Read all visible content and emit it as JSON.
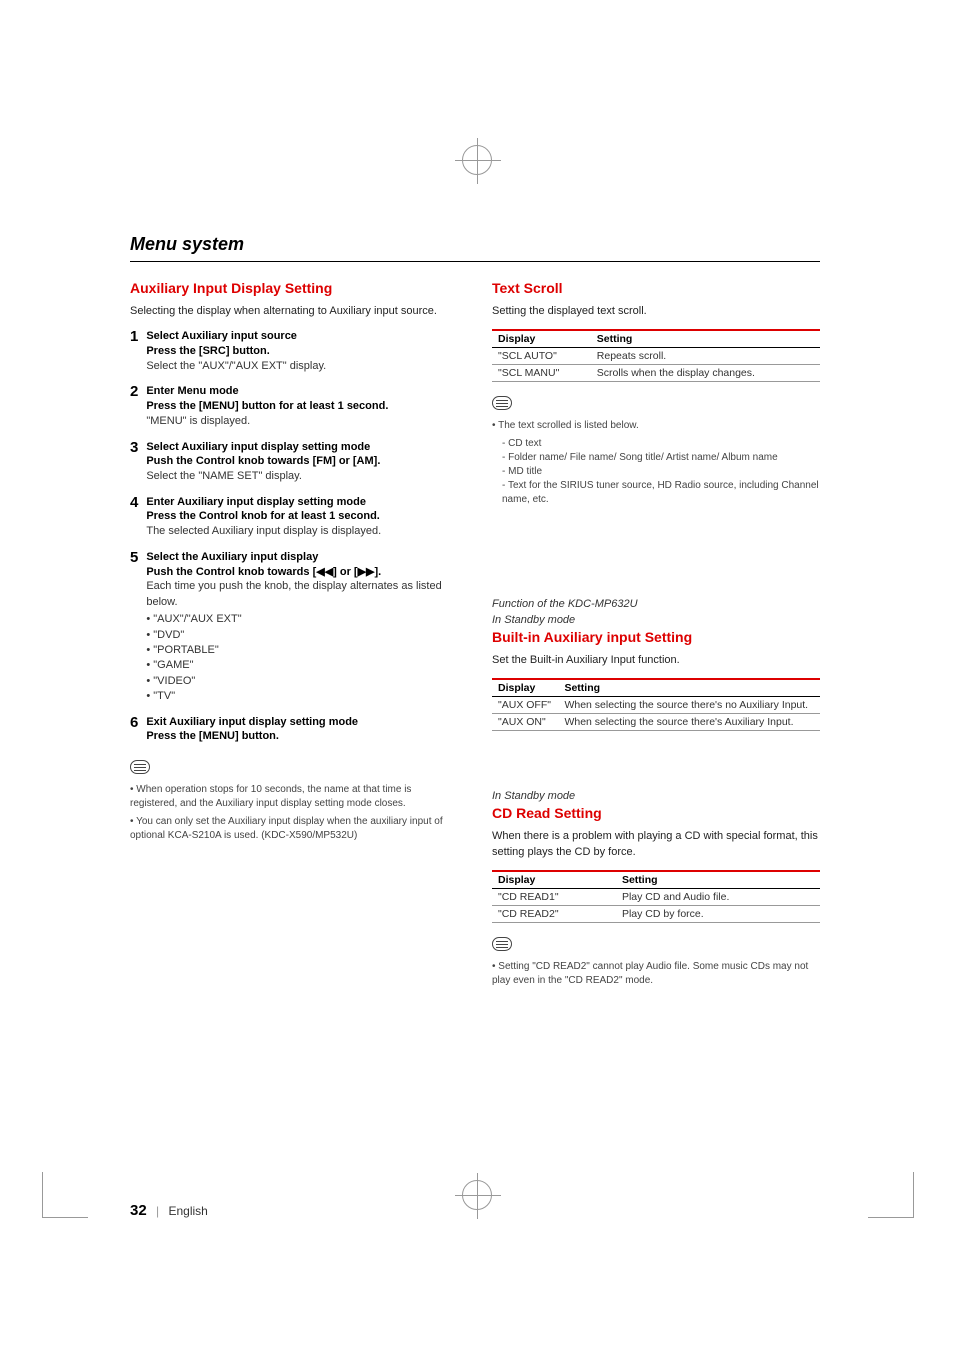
{
  "page_title": "Menu system",
  "footer": {
    "page_number": "32",
    "lang": "English"
  },
  "left": {
    "section_title": "Auxiliary Input Display Setting",
    "lead": "Selecting the display when alternating to Auxiliary input source.",
    "steps": [
      {
        "n": "1",
        "head": "Select Auxiliary input source",
        "sub": "Press the [SRC] button.",
        "text": "Select the \"AUX\"/\"AUX EXT\" display."
      },
      {
        "n": "2",
        "head": "Enter Menu mode",
        "sub": "Press the [MENU] button for at least 1 second.",
        "text": "\"MENU\" is displayed."
      },
      {
        "n": "3",
        "head": "Select Auxiliary input display setting mode",
        "sub": "Push the Control knob towards [FM] or [AM].",
        "text": "Select the \"NAME SET\" display."
      },
      {
        "n": "4",
        "head": "Enter Auxiliary input display setting mode",
        "sub": "Press the Control knob for at least 1 second.",
        "text": "The selected Auxiliary input display is displayed."
      },
      {
        "n": "5",
        "head": "Select the Auxiliary input display",
        "sub": "Push the Control knob towards [◀◀] or [▶▶].",
        "text": "Each time you push the knob, the display alternates as listed below.",
        "bullets": [
          "\"AUX\"/\"AUX EXT\"",
          "\"DVD\"",
          "\"PORTABLE\"",
          "\"GAME\"",
          "\"VIDEO\"",
          "\"TV\""
        ]
      },
      {
        "n": "6",
        "head": "Exit Auxiliary input display setting mode",
        "sub": "Press the [MENU] button.",
        "text": ""
      }
    ],
    "notes": [
      "When operation stops for 10 seconds, the name at that time is registered, and the Auxiliary input display setting mode closes.",
      "You can only set the Auxiliary input display when the auxiliary input of optional KCA-S210A is used. (KDC-X590/MP532U)"
    ]
  },
  "right": {
    "text_scroll": {
      "title": "Text Scroll",
      "lead": "Setting the displayed text scroll.",
      "th_display": "Display",
      "th_setting": "Setting",
      "rows": [
        {
          "d": "\"SCL AUTO\"",
          "s": "Repeats scroll."
        },
        {
          "d": "\"SCL MANU\"",
          "s": "Scrolls when the display changes."
        }
      ],
      "note_intro": "The text scrolled is listed below.",
      "note_items": [
        "CD text",
        "Folder name/ File name/ Song title/ Artist name/ Album name",
        "MD title",
        "Text for the SIRIUS tuner source, HD Radio source, including Channel name, etc."
      ]
    },
    "builtin_aux": {
      "context1": "Function of the KDC-MP632U",
      "context2": "In Standby mode",
      "title": "Built-in Auxiliary input Setting",
      "lead": "Set the Built-in Auxiliary Input function.",
      "th_display": "Display",
      "th_setting": "Setting",
      "rows": [
        {
          "d": "\"AUX OFF\"",
          "s": "When selecting the source there's no Auxiliary Input."
        },
        {
          "d": "\"AUX ON\"",
          "s": "When selecting the source there's Auxiliary Input."
        }
      ]
    },
    "cd_read": {
      "context": "In Standby mode",
      "title": "CD Read Setting",
      "lead": "When there is a problem with playing a CD with special format, this setting plays the CD by force.",
      "th_display": "Display",
      "th_setting": "Setting",
      "rows": [
        {
          "d": "\"CD READ1\"",
          "s": "Play CD and Audio file."
        },
        {
          "d": "\"CD READ2\"",
          "s": "Play CD by force."
        }
      ],
      "note": "Setting \"CD READ2\" cannot play Audio file. Some music CDs may not play even in the \"CD READ2\" mode."
    }
  }
}
